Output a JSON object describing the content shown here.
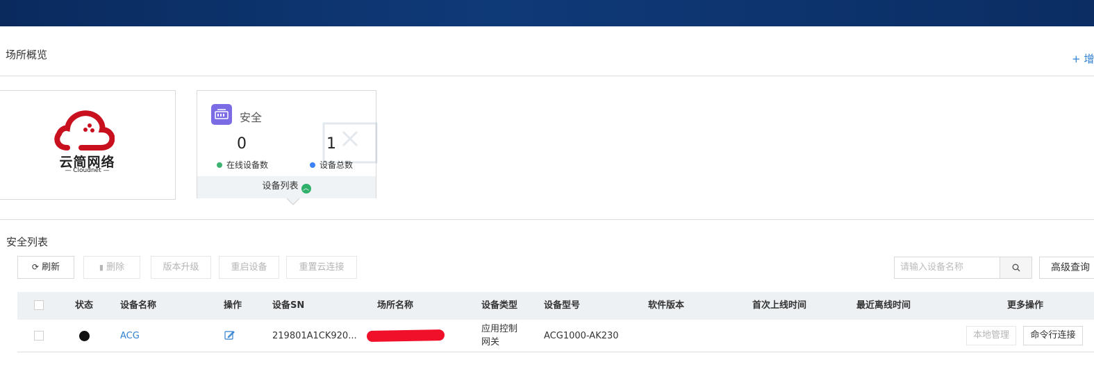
{
  "header": {
    "title": "场所概览",
    "add_label": "+ 增"
  },
  "cards": {
    "logo": {
      "brand_text": "云简网络",
      "brand_sub": "— Cloudnet —"
    },
    "security": {
      "title": "安全",
      "online_count": "0",
      "online_label": "在线设备数",
      "total_count": "1",
      "total_label": "设备总数",
      "footer_label": "设备列表"
    }
  },
  "colors": {
    "online_dot": "#3cb371",
    "total_dot": "#3b82f6",
    "accent": "#2f80d1",
    "icon_bg": "#7b6ce6"
  },
  "list": {
    "title": "安全列表",
    "toolbar": {
      "refresh": "刷新",
      "delete": "删除",
      "upgrade": "版本升级",
      "reboot": "重启设备",
      "reset_cloud": "重置云连接",
      "search_placeholder": "请输入设备名称",
      "advanced_search": "高级查询"
    },
    "columns": [
      "状态",
      "设备名称",
      "操作",
      "设备SN",
      "场所名称",
      "设备类型",
      "设备型号",
      "软件版本",
      "首次上线时间",
      "最近离线时间",
      "更多操作"
    ],
    "rows": [
      {
        "name": "ACG",
        "sn": "219801A1CK920...",
        "type_line1": "应用控制",
        "type_line2": "网关",
        "model": "ACG1000-AK230",
        "software_version": "",
        "first_online": "",
        "last_offline": "",
        "local_manage": "本地管理",
        "cli_connect": "命令行连接"
      }
    ]
  }
}
